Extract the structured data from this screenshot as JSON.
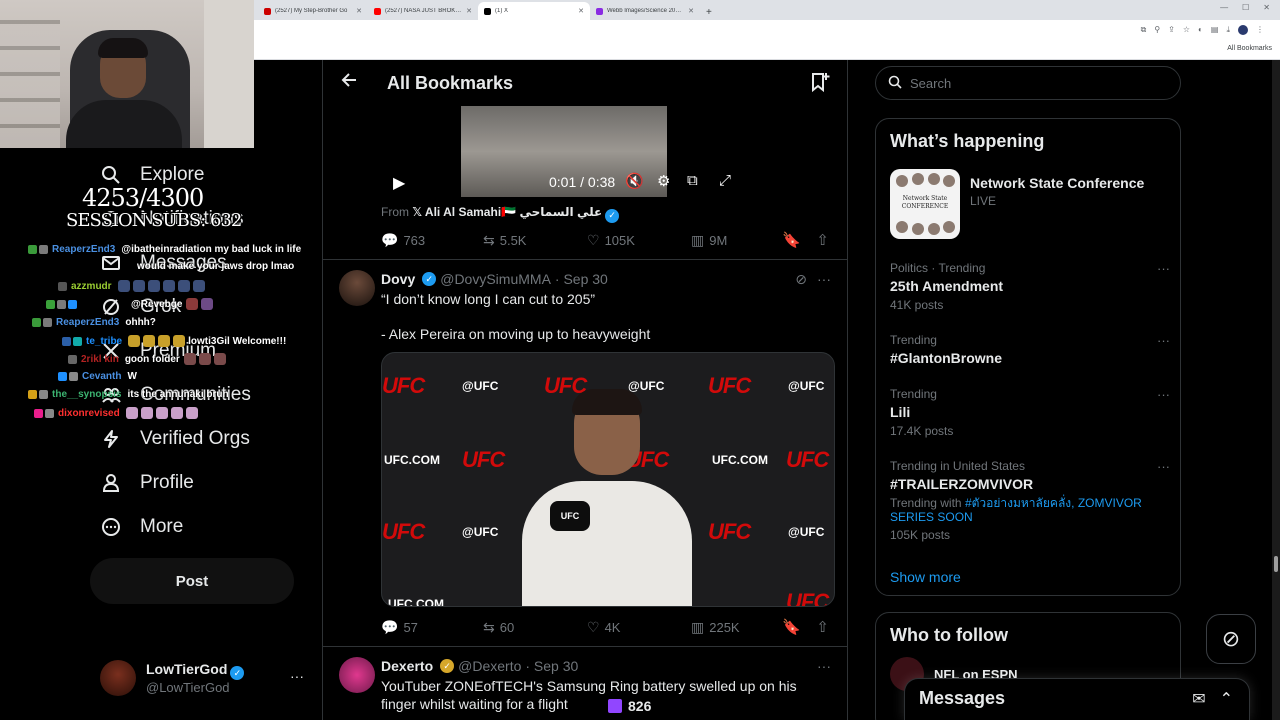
{
  "browser": {
    "tabs": [
      {
        "title": "(2527) My Step-Brother Go",
        "color": "#c00"
      },
      {
        "title": "(2527) NASA JUST BROKE THE",
        "color": "#f00"
      },
      {
        "title": "(1) X",
        "color": "#000",
        "active": true
      },
      {
        "title": "Webb Images/Science 2024 | N",
        "color": "#8a2be2"
      }
    ],
    "new_tab": "+",
    "all_bookmarks": "All Bookmarks"
  },
  "stream": {
    "sub_count": "4253/4300",
    "sub_label": "SESSION SUBS: 632",
    "viewers": "826",
    "chat": [
      {
        "user": "ReaperzEnd3",
        "user_color": "#4a90e2",
        "msg": "@ibatheinradiation my bad luck in life",
        "msg2": "would make your jaws drop lmao",
        "badges": [
          "#3a9a3a",
          "#7a7a7a"
        ]
      },
      {
        "user": "azzmudr",
        "user_color": "#9acd32",
        "msg": "",
        "emotes": 6,
        "badges": [
          "#555"
        ]
      },
      {
        "user": "",
        "user_color": "#8a2be2",
        "msg": "@Revebge",
        "emotes": 2,
        "badges": [
          "#3aa13a",
          "#7a7a7a",
          "#1e90ff"
        ]
      },
      {
        "user": "ReaperzEnd3",
        "user_color": "#4a90e2",
        "msg": "ohhh?",
        "badges": [
          "#3a9a3a",
          "#7a7a7a"
        ]
      },
      {
        "user": "te_tribe",
        "user_color": "#1e90ff",
        "msg": "lowti3Gil Welcome!!!",
        "emotes": 4,
        "badges": [
          "#2b5fa8",
          "#1aa"
        ]
      },
      {
        "user": "2rikl kin",
        "user_color": "#b22222",
        "msg": "goon folder",
        "emotes": 3,
        "badges": [
          "#666"
        ]
      },
      {
        "user": "Cevanth",
        "user_color": "#4a90e2",
        "msg": "W",
        "badges": [
          "#1e90ff",
          "#888"
        ]
      },
      {
        "user": "the__synopsis",
        "user_color": "#3cb371",
        "msg": "its the annunaki bruh",
        "badges": [
          "#d4a017",
          "#888"
        ]
      },
      {
        "user": "dixonrevised",
        "user_color": "#ff3030",
        "msg": "",
        "emotes": 5,
        "badges": [
          "#e91e8c",
          "#888"
        ]
      }
    ]
  },
  "nav": {
    "items": [
      {
        "label": "Explore",
        "icon": "search-icon"
      },
      {
        "label": "Notifications",
        "icon": "bell-icon"
      },
      {
        "label": "Messages",
        "icon": "mail-icon"
      },
      {
        "label": "Grok",
        "icon": "grok-icon"
      },
      {
        "label": "Premium",
        "icon": "x-icon"
      },
      {
        "label": "Communities",
        "icon": "people-icon"
      },
      {
        "label": "Verified Orgs",
        "icon": "lightning-icon"
      },
      {
        "label": "Profile",
        "icon": "person-icon"
      },
      {
        "label": "More",
        "icon": "more-circle-icon"
      }
    ],
    "post_button": "Post",
    "account": {
      "name": "LowTierGod",
      "handle": "@LowTierGod",
      "more": "···"
    }
  },
  "main": {
    "title": "All Bookmarks",
    "video": {
      "time": "0:01 / 0:38"
    },
    "from_prefix": "From",
    "from_name": "Ali Al Samahi🇦🇪 علي السماحي",
    "tweet1_actions": {
      "replies": "763",
      "reposts": "5.5K",
      "likes": "105K",
      "views": "9M"
    },
    "tweet2": {
      "name": "Dovy",
      "handle": "@DovySimuMMA",
      "date": "· Sep 30",
      "text1": "“I don’t know long I can cut to 205”",
      "text2": "- Alex Pereira on moving up to heavyweight",
      "image": {
        "logo": "UFC",
        "handle": "@UFC",
        "site": "UFC.COM"
      },
      "actions": {
        "replies": "57",
        "reposts": "60",
        "likes": "4K",
        "views": "225K"
      }
    },
    "tweet3": {
      "name": "Dexerto",
      "handle": "@Dexerto",
      "date": "· Sep 30",
      "text": "YouTuber ZONEofTECH's Samsung Ring battery swelled up on his finger whilst waiting for a flight"
    }
  },
  "right": {
    "search_placeholder": "Search",
    "whats_happening": "What’s happening",
    "event": {
      "name": "Network State Conference",
      "status": "LIVE",
      "image_text": "Network State CONFERENCE"
    },
    "trends": [
      {
        "context": "Politics · Trending",
        "name": "25th Amendment",
        "posts": "41K posts"
      },
      {
        "context": "Trending",
        "name": "#GlantonBrowne",
        "posts": ""
      },
      {
        "context": "Trending",
        "name": "Lili",
        "posts": "17.4K posts"
      },
      {
        "context": "Trending in United States",
        "name": "#TRAILERZOMVIVOR",
        "with_prefix": "Trending with",
        "with_links": "#ตัวอย่างมหาลัยคลั่ง, ZOMVIVOR SERIES SOON",
        "posts": "105K posts"
      }
    ],
    "show_more": "Show more",
    "who_to_follow": "Who to follow",
    "follow_name": "NFL on ESPN",
    "messages": "Messages"
  }
}
